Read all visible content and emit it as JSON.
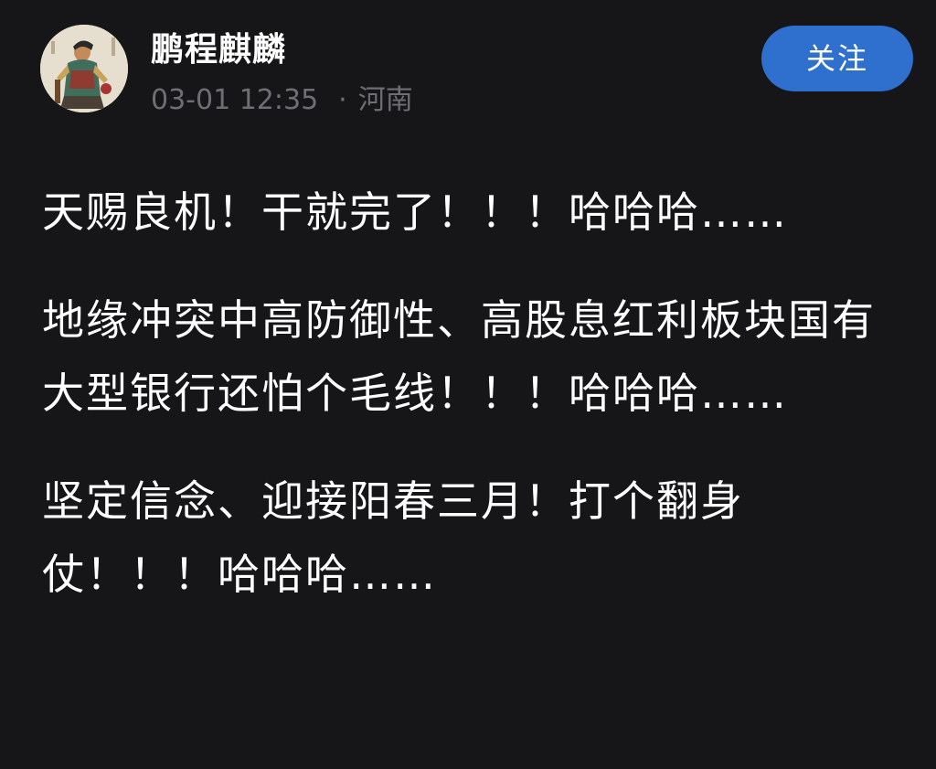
{
  "author": {
    "name": "鹏程麒麟",
    "time": "03-01 12:35",
    "location_separator": "·",
    "location": "河南",
    "avatar_icon": "figure-painting-avatar"
  },
  "follow_button": {
    "label": "关注",
    "color": "#2f6fce"
  },
  "post": {
    "paragraphs": [
      "天赐良机！干就完了！！！哈哈哈……",
      "地缘冲突中高防御性、高股息红利板块国有大型银行还怕个毛线！！！哈哈哈……",
      "坚定信念、迎接阳春三月！打个翻身仗！！！哈哈哈……"
    ]
  },
  "colors": {
    "background": "#161618",
    "text": "#ffffff",
    "meta": "#6e6e73"
  }
}
